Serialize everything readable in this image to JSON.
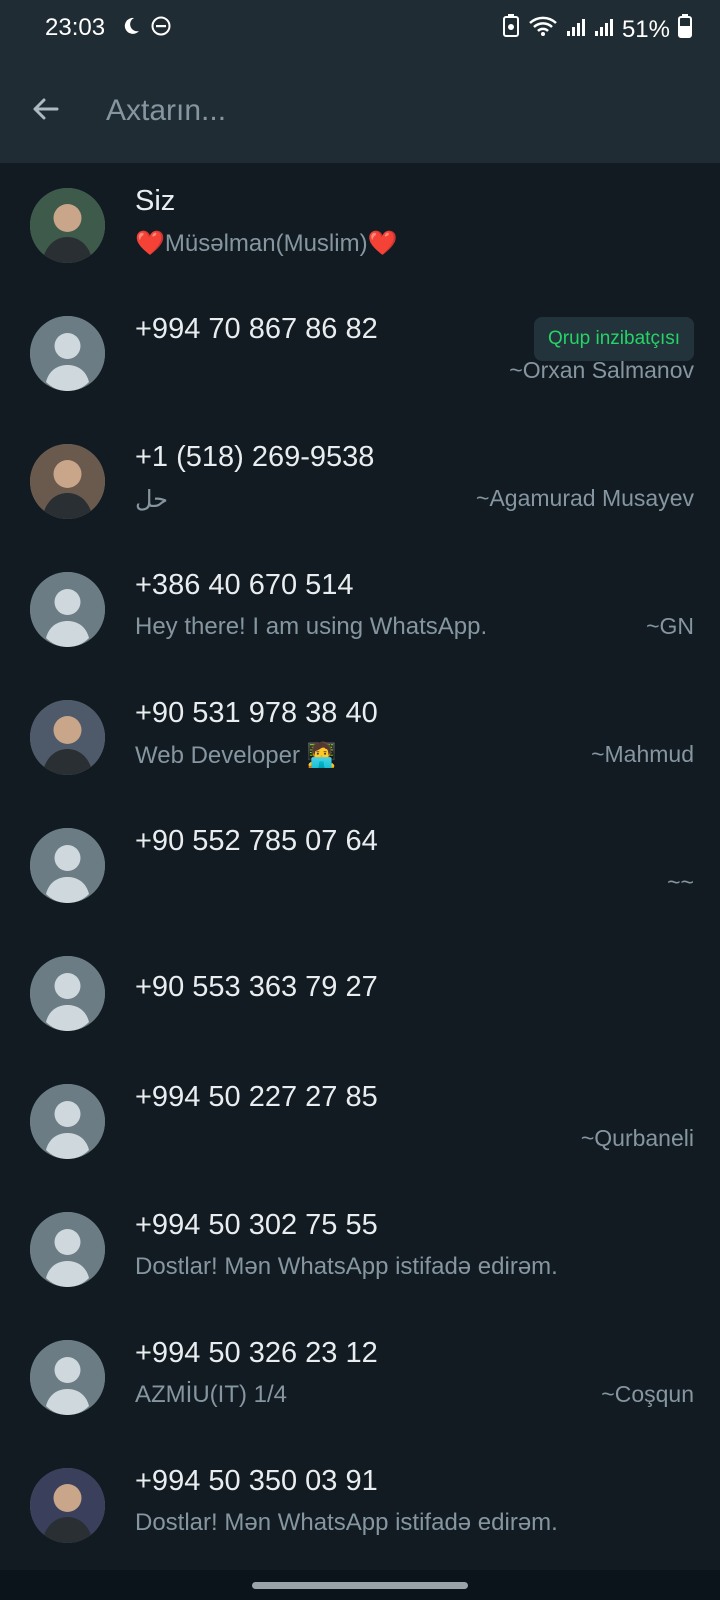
{
  "status_bar": {
    "time": "23:03",
    "battery": "51%"
  },
  "search": {
    "placeholder": "Axtarın..."
  },
  "contacts": [
    {
      "name": "Siz",
      "status": "❤️Müsəlman(Muslim)❤️",
      "pushname": "",
      "badge": "",
      "avatar": "photo-icon"
    },
    {
      "name": "+994 70 867 86 82",
      "status": "",
      "pushname": "~Orxan Salmanov",
      "badge": "Qrup inzibatçısı",
      "avatar": "default-avatar-icon"
    },
    {
      "name": "+1 (518) 269-9538",
      "status": "حل",
      "pushname": "~Agamurad Musayev",
      "badge": "",
      "avatar": "photo-icon"
    },
    {
      "name": "+386 40 670 514",
      "status": "Hey there! I am using WhatsApp.",
      "pushname": "~GN",
      "badge": "",
      "avatar": "default-avatar-icon"
    },
    {
      "name": "+90 531 978 38 40",
      "status": "Web Developer 🧑‍💻",
      "pushname": "~Mahmud",
      "badge": "",
      "avatar": "photo-icon"
    },
    {
      "name": "+90 552 785 07 64",
      "status": "",
      "pushname": "~~",
      "badge": "",
      "avatar": "default-avatar-icon"
    },
    {
      "name": "+90 553 363 79 27",
      "status": "",
      "pushname": "",
      "badge": "",
      "avatar": "default-avatar-icon"
    },
    {
      "name": "+994 50 227 27 85",
      "status": "",
      "pushname": "~Qurbaneli",
      "badge": "",
      "avatar": "default-avatar-icon"
    },
    {
      "name": "+994 50 302 75 55",
      "status": "Dostlar! Mən WhatsApp istifadə edirəm.",
      "pushname": "",
      "badge": "",
      "avatar": "default-avatar-icon"
    },
    {
      "name": "+994 50 326 23 12",
      "status": "AZMİU(IT) 1/4",
      "pushname": "~Coşqun",
      "badge": "",
      "avatar": "default-avatar-icon"
    },
    {
      "name": "+994 50 350 03 91",
      "status": "Dostlar! Mən WhatsApp istifadə edirəm.",
      "pushname": "",
      "badge": "",
      "avatar": "photo-icon"
    }
  ]
}
